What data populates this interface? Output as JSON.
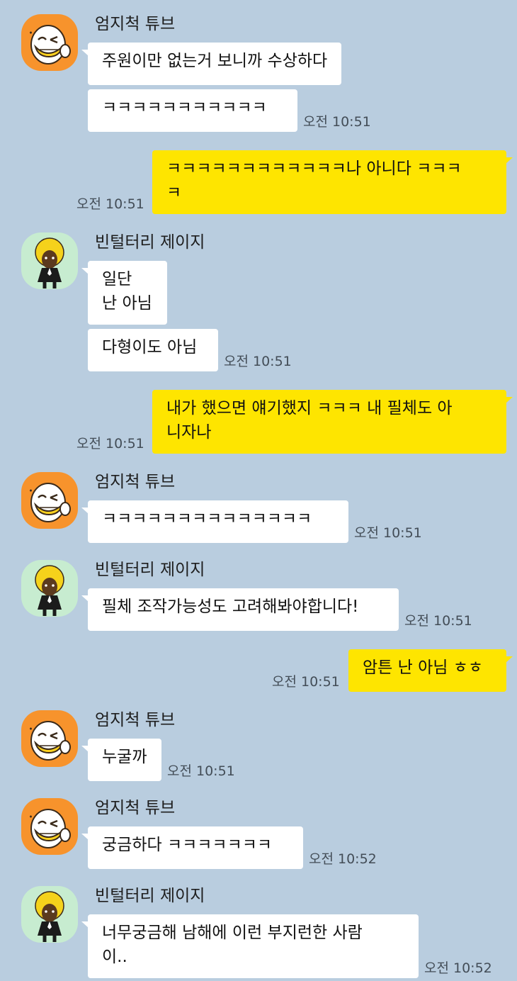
{
  "colors": {
    "background": "#b9cddf",
    "my_bubble": "#fee500",
    "other_bubble": "#ffffff"
  },
  "senders": {
    "umji": "엄지척 튜브",
    "jay": "빈털터리 제이지"
  },
  "messages": [
    {
      "text": "주원이만 없는거 보니까 수상하다"
    },
    {
      "text": "ㅋㅋㅋㅋㅋㅋㅋㅋㅋㅋㅋ",
      "time": "오전 10:51"
    },
    {
      "text": "ㅋㅋㅋㅋㅋㅋㅋㅋㅋㅋㅋㅋ나 아니다 ㅋㅋㅋ\nㅋ",
      "time": "오전 10:51"
    },
    {
      "text": "일단\n난 아님"
    },
    {
      "text": "다형이도 아님",
      "time": "오전 10:51"
    },
    {
      "text": "내가 했으면 얘기했지 ㅋㅋㅋ 내 필체도 아\n니자나",
      "time": "오전 10:51"
    },
    {
      "text": "ㅋㅋㅋㅋㅋㅋㅋㅋㅋㅋㅋㅋㅋㅋ",
      "time": "오전 10:51"
    },
    {
      "text": "필체 조작가능성도 고려해봐야합니다!",
      "time": "오전 10:51"
    },
    {
      "text": "암튼 난 아님 ㅎㅎ",
      "time": "오전 10:51"
    },
    {
      "text": "누굴까",
      "time": "오전 10:51"
    },
    {
      "text": "궁금하다 ㅋㅋㅋㅋㅋㅋㅋ",
      "time": "오전 10:52"
    },
    {
      "text": "너무궁금해 남해에 이런 부지런한 사람\n이..",
      "time": "오전 10:52"
    }
  ]
}
